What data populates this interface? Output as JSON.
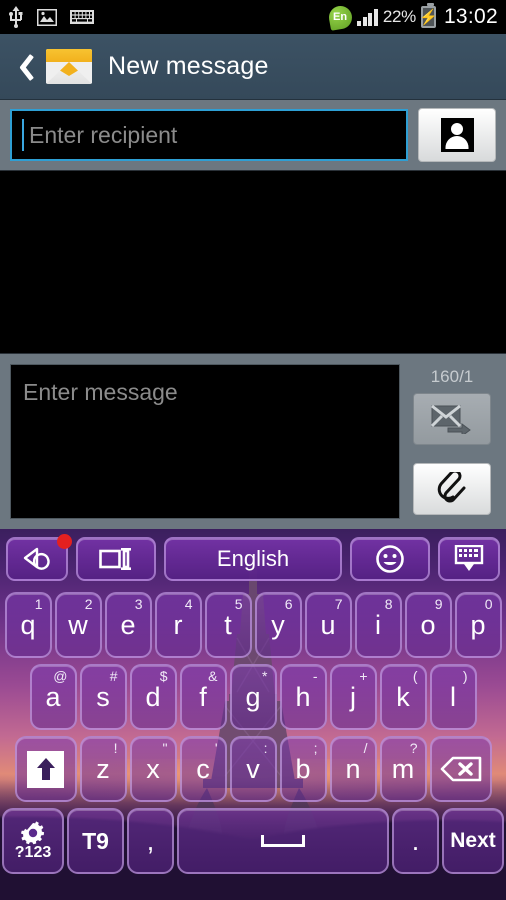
{
  "statusbar": {
    "icons": [
      "usb-icon",
      "image-icon",
      "keyboard-icon"
    ],
    "language_badge": "En",
    "battery_percent": "22%",
    "clock": "13:02"
  },
  "titlebar": {
    "back_label": "back-chevron",
    "icon": "envelope-icon",
    "title": "New message"
  },
  "recipient": {
    "placeholder": "Enter recipient",
    "value": "",
    "contacts_button": "contacts-picker"
  },
  "compose": {
    "placeholder": "Enter message",
    "value": "",
    "counter": "160/1",
    "send_button": "send-message",
    "attach_button": "add-attachment"
  },
  "keyboard": {
    "theme_name": "eiffel-tower-purple",
    "toolbar": [
      {
        "name": "theme-key",
        "label": "",
        "badge": true
      },
      {
        "name": "resize-key",
        "label": ""
      },
      {
        "name": "language-key",
        "label": "English"
      },
      {
        "name": "emoji-key",
        "label": ""
      },
      {
        "name": "hide-keyboard-key",
        "label": ""
      }
    ],
    "row1": [
      {
        "key": "q",
        "alt": "1"
      },
      {
        "key": "w",
        "alt": "2"
      },
      {
        "key": "e",
        "alt": "3"
      },
      {
        "key": "r",
        "alt": "4"
      },
      {
        "key": "t",
        "alt": "5"
      },
      {
        "key": "y",
        "alt": "6"
      },
      {
        "key": "u",
        "alt": "7"
      },
      {
        "key": "i",
        "alt": "8"
      },
      {
        "key": "o",
        "alt": "9"
      },
      {
        "key": "p",
        "alt": "0"
      }
    ],
    "row2": [
      {
        "key": "a",
        "alt": "@"
      },
      {
        "key": "s",
        "alt": "#"
      },
      {
        "key": "d",
        "alt": "$"
      },
      {
        "key": "f",
        "alt": "&"
      },
      {
        "key": "g",
        "alt": "*"
      },
      {
        "key": "h",
        "alt": "-"
      },
      {
        "key": "j",
        "alt": "+"
      },
      {
        "key": "k",
        "alt": "("
      },
      {
        "key": "l",
        "alt": ")"
      }
    ],
    "row3": [
      {
        "key": "z",
        "alt": "!"
      },
      {
        "key": "x",
        "alt": "\""
      },
      {
        "key": "c",
        "alt": "'"
      },
      {
        "key": "v",
        "alt": ":"
      },
      {
        "key": "b",
        "alt": ";"
      },
      {
        "key": "n",
        "alt": "/"
      },
      {
        "key": "m",
        "alt": "?"
      }
    ],
    "shift_label": "shift",
    "backspace_label": "backspace",
    "row4": {
      "symbols_label": "?123",
      "t9_label": "T9",
      "comma_label": ",",
      "space_label": "",
      "period_label": ".",
      "next_label": "Next"
    }
  },
  "colors": {
    "titlebar": "#35495a",
    "chrome_gray": "#6c7780",
    "field_border_focus": "#2e9fd4",
    "key_purple": "#7d3ab0",
    "badge_red": "#e32020",
    "envelope_yellow": "#f2b11d",
    "leaf_green": "#5f9e23"
  }
}
